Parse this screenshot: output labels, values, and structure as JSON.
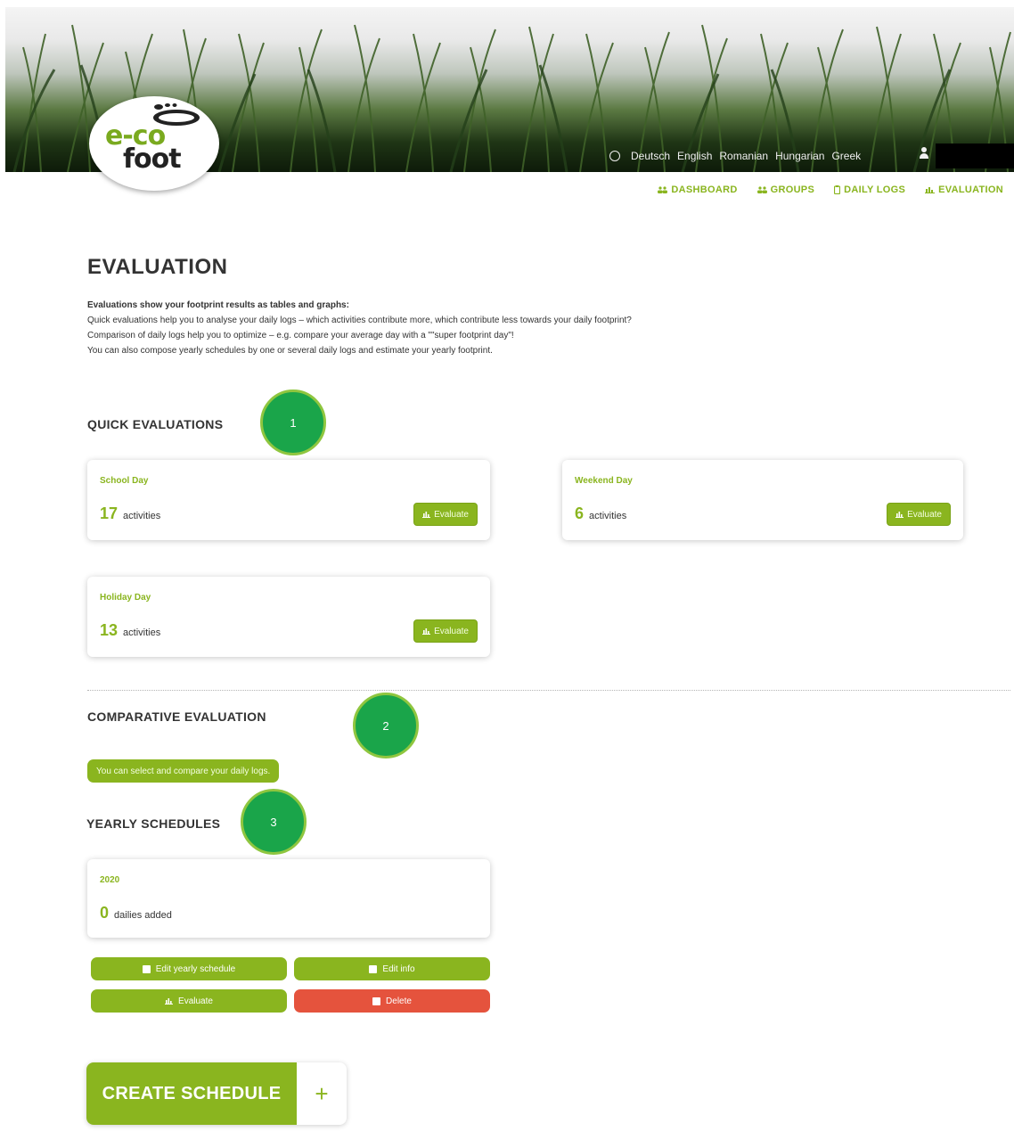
{
  "header": {
    "logo": {
      "line1": "e-co",
      "line2": "foot"
    },
    "languages": [
      "Deutsch",
      "English",
      "Romanian",
      "Hungarian",
      "Greek"
    ],
    "nav": [
      {
        "label": "DASHBOARD",
        "icon": "users-icon"
      },
      {
        "label": "GROUPS",
        "icon": "users-icon"
      },
      {
        "label": "DAILY LOGS",
        "icon": "clipboard-icon"
      },
      {
        "label": "EVALUATION",
        "icon": "bar-chart-icon"
      }
    ]
  },
  "page": {
    "title": "EVALUATION",
    "intro": {
      "heading": "Evaluations show your footprint results as tables and graphs:",
      "lines": [
        "Quick evaluations help you to analyse your daily logs – which activities contribute more, which contribute less towards your daily footprint?",
        "Comparison of daily logs help you to optimize – e.g. compare your average day with a \"\"super footprint day\"!",
        "You can also compose yearly schedules by one or several daily logs and estimate your yearly footprint."
      ]
    }
  },
  "quick": {
    "title": "QUICK EVALUATIONS",
    "marker": "1",
    "cards": [
      {
        "name": "School Day",
        "count": "17",
        "unit": "activities",
        "button": "Evaluate"
      },
      {
        "name": "Weekend Day",
        "count": "6",
        "unit": "activities",
        "button": "Evaluate"
      },
      {
        "name": "Holiday Day",
        "count": "13",
        "unit": "activities",
        "button": "Evaluate"
      }
    ]
  },
  "comparative": {
    "title": "COMPARATIVE EVALUATION",
    "marker": "2",
    "pill": "You can select and compare your daily logs."
  },
  "yearly": {
    "title": "YEARLY SCHEDULES",
    "marker": "3",
    "schedule": {
      "name": "2020",
      "count": "0",
      "unit": "dailies added"
    },
    "buttons": {
      "edit_schedule": "Edit yearly schedule",
      "edit_info": "Edit info",
      "evaluate": "Evaluate",
      "delete": "Delete"
    },
    "create": {
      "label": "CREATE SCHEDULE",
      "plus": "+"
    }
  },
  "colors": {
    "accent": "#8ab51f",
    "marker": "#1aa54a",
    "danger": "#e5533d"
  }
}
